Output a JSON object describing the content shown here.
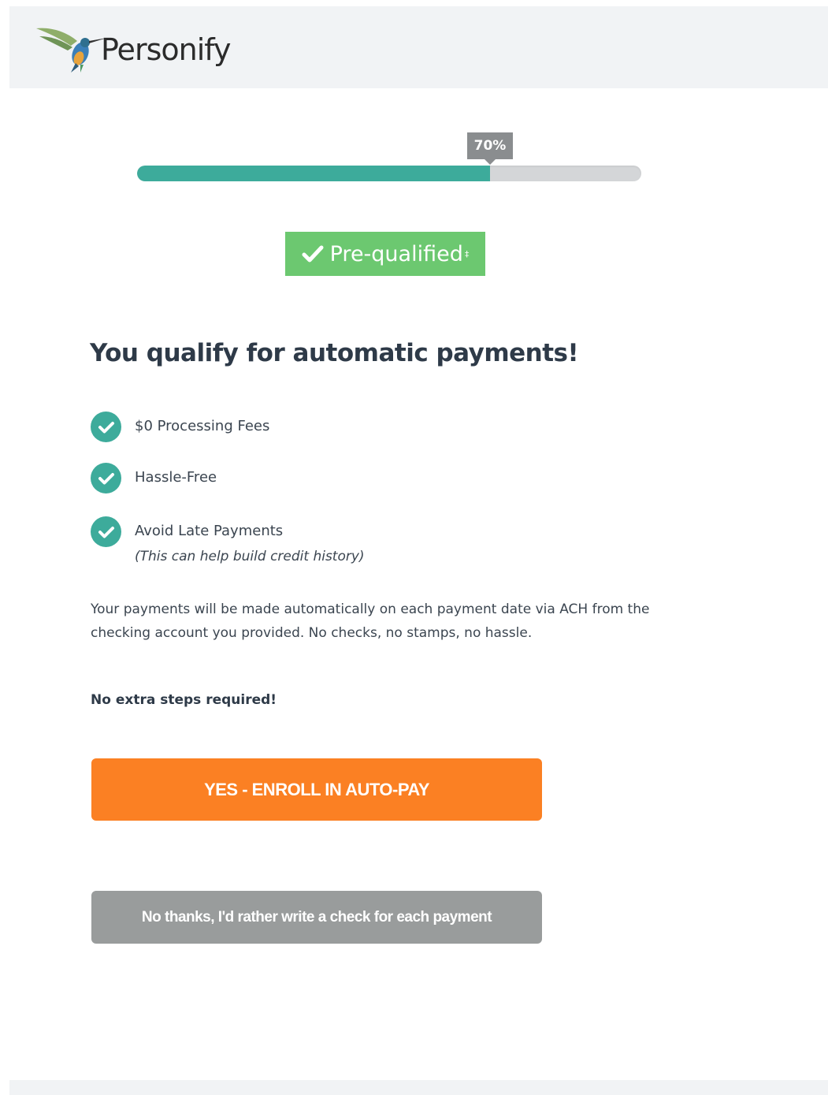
{
  "header": {
    "brand": "Personify",
    "logo_icon": "hummingbird-icon"
  },
  "progress": {
    "value": 0.7,
    "label": "70%",
    "colors": {
      "fill": "#3dab9b",
      "track": "#d4d6d8",
      "label_bg": "#8a8d8f"
    }
  },
  "badge": {
    "icon": "check-icon",
    "text": "Pre-qualified",
    "footnote_mark": "‡",
    "color": "#6cc870"
  },
  "main": {
    "title": "You qualify for automatic payments!",
    "benefits": [
      {
        "icon": "check-circle-icon",
        "label": "$0 Processing Fees"
      },
      {
        "icon": "check-circle-icon",
        "label": "Hassle-Free"
      },
      {
        "icon": "check-circle-icon",
        "label": "Avoid Late Payments",
        "note": "(This can help build credit history)"
      }
    ],
    "description_line1": "Your payments will be made automatically on each payment date via ACH from the",
    "description_line2": "checking account you provided. No checks, no stamps, no hassle.",
    "subnote": "No extra steps required!"
  },
  "actions": {
    "enroll_label": "YES - ENROLL IN AUTO-PAY",
    "decline_label": "No thanks, I'd rather write a check for each payment",
    "enroll_color": "#fb8023",
    "decline_color": "#999c9c"
  }
}
